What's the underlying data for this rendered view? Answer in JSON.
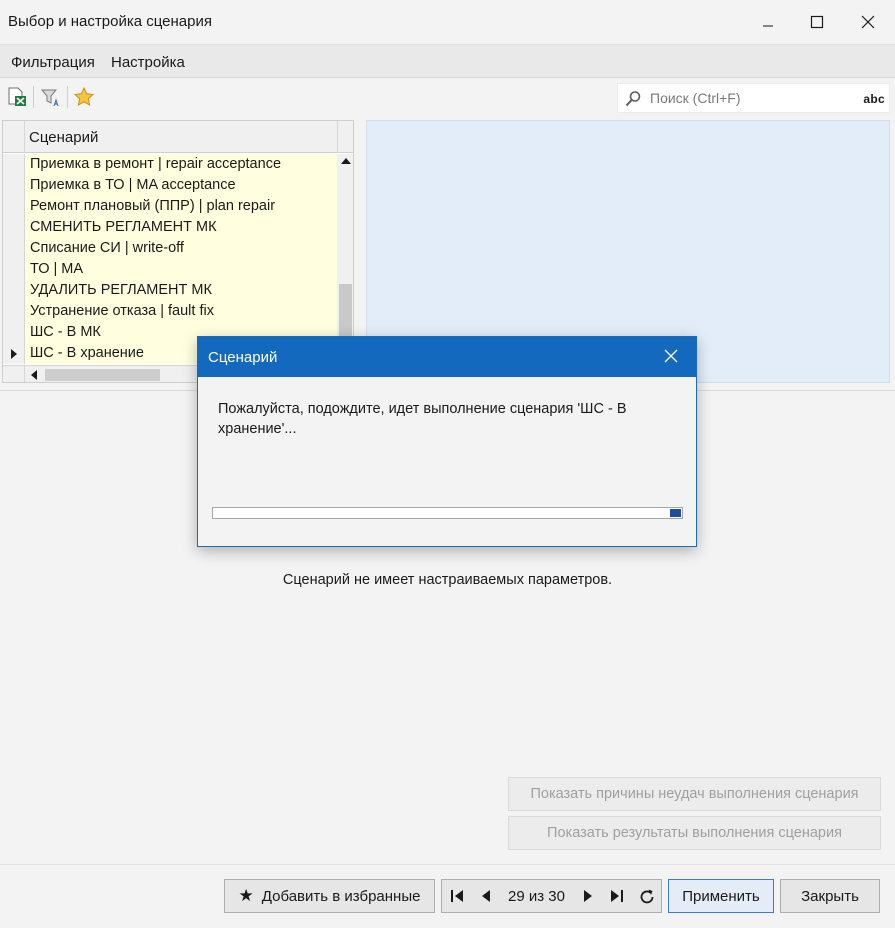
{
  "window": {
    "title": "Выбор и настройка сценария"
  },
  "menu": {
    "items": [
      "Фильтрация",
      "Настройка"
    ]
  },
  "toolbar": {
    "icons": [
      "excel-export-icon",
      "filter-icon",
      "star-icon"
    ],
    "search_placeholder": "Поиск (Ctrl+F)",
    "spell_label": "abc"
  },
  "grid": {
    "column_header": "Сценарий",
    "rows": [
      "Приемка в ремонт | repair acceptance",
      "Приемка в ТО | MA acceptance",
      "Ремонт плановый (ППР) | plan repair",
      "СМЕНИТЬ РЕГЛАМЕНТ МК",
      "Списание СИ | write-off",
      "ТО | MA",
      "УДАЛИТЬ РЕГЛАМЕНТ МК",
      "Устранение отказа | fault fix",
      "ШС - В МК",
      "ШС - В хранение"
    ],
    "row_background": "#ffffe0",
    "current_row_index": 9
  },
  "params": {
    "message": "Сценарий не имеет настраиваемых параметров."
  },
  "side_buttons": {
    "show_failures": "Показать причины неудач выполнения сценария",
    "show_results": "Показать результаты выполнения сценария"
  },
  "bottom": {
    "favorite_label": "Добавить в избранные",
    "position_text": "29 из 30",
    "apply_label": "Применить",
    "close_label": "Закрыть"
  },
  "dialog": {
    "title": "Сценарий",
    "message": "Пожалуйста, подождите, идет выполнение сценария 'ШС - В хранение'...",
    "accent_color": "#1369bd",
    "progress_indicator_color": "#1e4f9c"
  }
}
